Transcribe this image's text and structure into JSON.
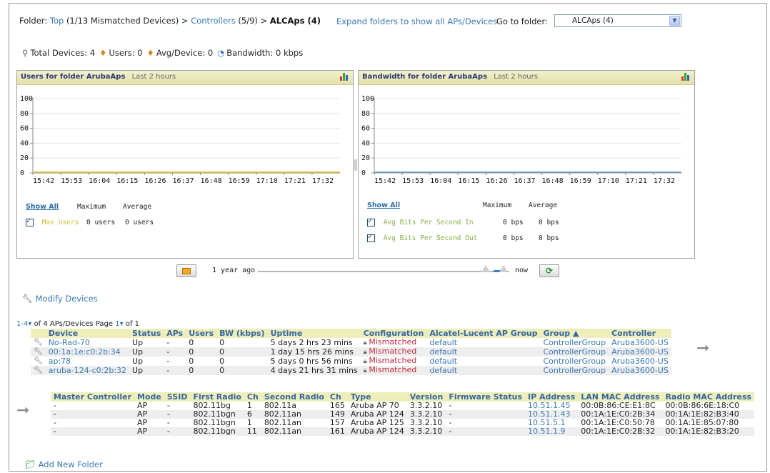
{
  "breadcrumb": {
    "prefix": "Folder:",
    "top_link": "Top",
    "top_count": "(1/13 Mismatched Devices)",
    "sep": ">",
    "controllers_link": "Controllers",
    "controllers_count": "(5/9)",
    "current": "ALCAps (4)"
  },
  "expand_link": "Expand folders to show all APs/Devices",
  "goto": {
    "label": "Go to folder:",
    "selected": "ALCAps (4)"
  },
  "stats": {
    "total_devices": "Total Devices: 4",
    "users": "Users: 0",
    "avg_device": "Avg/Device: 0",
    "bandwidth": "Bandwidth: 0 kbps"
  },
  "users_chart": {
    "title": "Users for folder ArubaAps",
    "range": "Last 2 hours",
    "show_all": "Show All",
    "col_max": "Maximum",
    "col_avg": "Average",
    "series": [
      {
        "name": "Max Users",
        "max": "0 users",
        "avg": "0 users"
      }
    ]
  },
  "bw_chart": {
    "title": "Bandwidth for folder ArubaAps",
    "range": "Last 2 hours",
    "show_all": "Show All",
    "col_max": "Maximum",
    "col_avg": "Average",
    "series": [
      {
        "name": "Avg Bits Per Second In",
        "max": "0 bps",
        "avg": "0 bps"
      },
      {
        "name": "Avg Bits Per Second Out",
        "max": "0 bps",
        "avg": "0 bps"
      }
    ]
  },
  "chart_data": [
    {
      "type": "line",
      "title": "Users for folder ArubaAps",
      "x": [
        "15:42",
        "15:53",
        "16:04",
        "16:15",
        "16:26",
        "16:37",
        "16:48",
        "16:59",
        "17:10",
        "17:21",
        "17:32"
      ],
      "series": [
        {
          "name": "Max Users",
          "values": [
            0,
            0,
            0,
            0,
            0,
            0,
            0,
            0,
            0,
            0,
            0
          ],
          "color": "#d9c52a"
        }
      ],
      "yticks": [
        0,
        20,
        40,
        60,
        80,
        100
      ],
      "ylim": [
        0,
        100
      ],
      "grid": true
    },
    {
      "type": "line",
      "title": "Bandwidth for folder ArubaAps",
      "x": [
        "15:42",
        "15:53",
        "16:04",
        "16:15",
        "16:26",
        "16:37",
        "16:48",
        "16:59",
        "17:10",
        "17:21",
        "17:32"
      ],
      "series": [
        {
          "name": "Avg Bits Per Second In",
          "values": [
            0,
            0,
            0,
            0,
            0,
            0,
            0,
            0,
            0,
            0,
            0
          ],
          "color": "#8db04a"
        },
        {
          "name": "Avg Bits Per Second Out",
          "values": [
            0,
            0,
            0,
            0,
            0,
            0,
            0,
            0,
            0,
            0,
            0
          ],
          "color": "#6c9bd2"
        }
      ],
      "yticks": [
        0,
        20,
        40,
        60,
        80,
        100
      ],
      "ylim": [
        0,
        100
      ],
      "grid": true
    }
  ],
  "slider": {
    "start_label": "1 year ago",
    "end_label": "now"
  },
  "modify_devices": "Modify Devices",
  "pager": {
    "range": "1-4",
    "of_total": "of 4 APs/Devices",
    "page_label": "Page",
    "page": "1",
    "of_pages": "of 1"
  },
  "devices_table": {
    "headers": [
      "Device",
      "Status",
      "APs",
      "Users",
      "BW (kbps)",
      "Uptime",
      "Configuration",
      "Alcatel-Lucent AP Group",
      "Group ▲",
      "Controller"
    ],
    "rows": [
      [
        "No-Rad-70",
        "Up",
        "-",
        "0",
        "0",
        "5 days 2 hrs 23 mins",
        "Mismatched",
        "default",
        "ControllerGroup",
        "Aruba3600-US"
      ],
      [
        "00:1a:1e:c0:2b:34",
        "Up",
        "-",
        "0",
        "0",
        "1 day 15 hrs 26 mins",
        "Mismatched",
        "default",
        "ControllerGroup",
        "Aruba3600-US"
      ],
      [
        "ap:78",
        "Up",
        "-",
        "0",
        "0",
        "5 days 0 hrs 56 mins",
        "Mismatched",
        "default",
        "ControllerGroup",
        "Aruba3600-US"
      ],
      [
        "aruba-124-c0:2b:32",
        "Up",
        "-",
        "0",
        "0",
        "4 days 21 hrs 31 mins",
        "Mismatched",
        "default",
        "ControllerGroup",
        "Aruba3600-US"
      ]
    ]
  },
  "radio_table": {
    "headers": [
      "Master Controller",
      "Mode",
      "SSID",
      "First Radio",
      "Ch",
      "Second Radio",
      "Ch",
      "Type",
      "Version",
      "Firmware Status",
      "IP Address",
      "LAN MAC Address",
      "Radio MAC Address"
    ],
    "rows": [
      [
        "-",
        "AP",
        "-",
        "802.11bg",
        "1",
        "802.11a",
        "165",
        "Aruba AP 70",
        "3.3.2.10",
        "-",
        "10.51.1.45",
        "00:0B:86:CE:E1:8C",
        "00:0B:86:6E:18:C0"
      ],
      [
        "-",
        "AP",
        "-",
        "802.11bgn",
        "6",
        "802.11an",
        "149",
        "Aruba AP 124",
        "3.3.2.10",
        "-",
        "10.51.1.43",
        "00:1A:1E:C0:2B:34",
        "00:1A:1E:82:B3:40"
      ],
      [
        "-",
        "AP",
        "-",
        "802.11bgn",
        "1",
        "802.11an",
        "157",
        "Aruba AP 125",
        "3.3.2.10",
        "-",
        "10.51.5.1",
        "00:1A:1E:C0:50:78",
        "00:1A:1E:85:07:80"
      ],
      [
        "-",
        "AP",
        "-",
        "802.11bgn",
        "11",
        "802.11an",
        "161",
        "Aruba AP 124",
        "3.3.2.10",
        "-",
        "10.51.1.9",
        "00:1A:1E:C0:2B:32",
        "00:1A:1E:82:B3:20"
      ]
    ]
  },
  "add_new_folder": "Add New Folder",
  "colors": {
    "link": "#3a79b5",
    "mismatch": "#cc2b3e",
    "header_bg": "#eeeebb",
    "panel_title_bg": "#e3e0a8"
  }
}
